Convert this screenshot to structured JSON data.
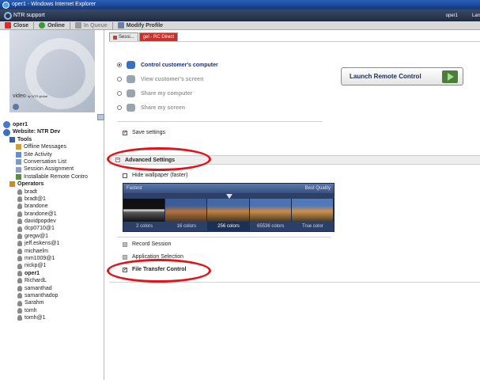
{
  "window": {
    "title": "oper1 - Windows Internet Explorer"
  },
  "brand": {
    "name": "NTR support",
    "user": "oper1",
    "lang": "Lan"
  },
  "toolbar": {
    "items": [
      {
        "label": "Close",
        "icon": "close-icon",
        "disabled": false
      },
      {
        "label": "Online",
        "icon": "online-icon",
        "disabled": false
      },
      {
        "label": "In Queue",
        "icon": "queue-icon",
        "disabled": true
      },
      {
        "label": "Modify Profile",
        "icon": "profile-icon",
        "disabled": false
      }
    ]
  },
  "video": {
    "label": "video",
    "sublabel": "by NTR global"
  },
  "tree": {
    "user": "oper1",
    "website": "Website: NTR Dev",
    "tools_label": "Tools",
    "tools": [
      "Offline Messages",
      "Site Activity",
      "Conversation List",
      "Session Assignment",
      "Installable Remote Contro"
    ],
    "operators_label": "Operators",
    "operators": [
      "bradt",
      "bradt@1",
      "brandone",
      "brandone@1",
      "davidpopdev",
      "dcp0710@1",
      "gregw@1",
      "jeff.eskens@1",
      "michaelm",
      "mm1009@1",
      "nickp@1",
      "oper1",
      "RichardL",
      "samanthad",
      "samanthadop",
      "Sarahm",
      "tomh",
      "tomh@1"
    ],
    "bold_operator": "oper1"
  },
  "tabs": [
    {
      "label": "Sessi...",
      "active": false
    },
    {
      "label": "gel - RC Direct",
      "active": true
    }
  ],
  "modes": [
    {
      "label": "Control customer's computer",
      "selected": true,
      "enabled": true
    },
    {
      "label": "View customer's screen",
      "selected": false,
      "enabled": false
    },
    {
      "label": "Share my computer",
      "selected": false,
      "enabled": false
    },
    {
      "label": "Share my screen",
      "selected": false,
      "enabled": false
    }
  ],
  "launch_button": {
    "label": "Launch Remote Control"
  },
  "save_settings": {
    "label": "Save settings",
    "checked": true
  },
  "advanced": {
    "label": "Advanced Settings",
    "hide_wallpaper": {
      "label": "Hide wallpaper (faster)",
      "checked": false
    },
    "quality": {
      "left_label": "Fastest",
      "right_label": "Best Quality",
      "options": [
        "2 colors",
        "16 colors",
        "256 colors",
        "65536 colors",
        "True color"
      ],
      "selected_index": 2
    },
    "record_session": {
      "label": "Record Session",
      "checked": false
    },
    "application_selection": {
      "label": "Application Selection",
      "checked": false
    },
    "file_transfer": {
      "label": "File Transfer Control",
      "checked": true
    }
  },
  "colors": {
    "accent_red": "#e0141a",
    "title_blue": "#1a2f7a",
    "toolbar_bg": "#d9d9d9"
  }
}
